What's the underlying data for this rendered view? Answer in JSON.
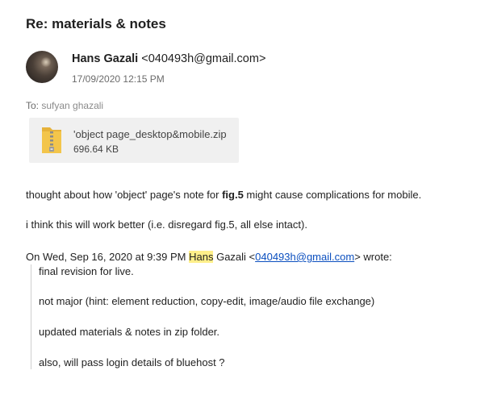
{
  "email": {
    "subject": "Re: materials & notes",
    "sender": {
      "name": "Hans Gazali",
      "email_display": "<040493h@gmail.com>"
    },
    "date": "17/09/2020 12:15 PM",
    "to_label": "To:",
    "recipient": "sufyan ghazali",
    "attachment": {
      "filename": "'object page_desktop&mobile.zip",
      "size": "696.64 KB",
      "icon": "zip-folder-icon"
    },
    "body": {
      "p1_before": "thought about how 'object' page's note for ",
      "p1_bold": "fig.5",
      "p1_after": " might cause complications for mobile.",
      "p2": "i think this will work better (i.e. disregard fig.5, all else intact)."
    },
    "quote": {
      "header_prefix": "On Wed, Sep 16, 2020 at 9:39 PM ",
      "header_highlight": "Hans",
      "header_mid": " Gazali <",
      "header_link": "040493h@gmail.com",
      "header_suffix": "> wrote:",
      "lines": [
        "final revision for live.",
        "not major (hint: element reduction, copy-edit, image/audio file exchange)",
        "updated materials & notes in zip folder.",
        "also, will pass login details of bluehost ?"
      ]
    }
  },
  "colors": {
    "link": "#0b4fbf",
    "highlight": "#ffef8a",
    "attachment_bg": "#f0f0f0",
    "zip_yellow": "#f3c54b"
  }
}
